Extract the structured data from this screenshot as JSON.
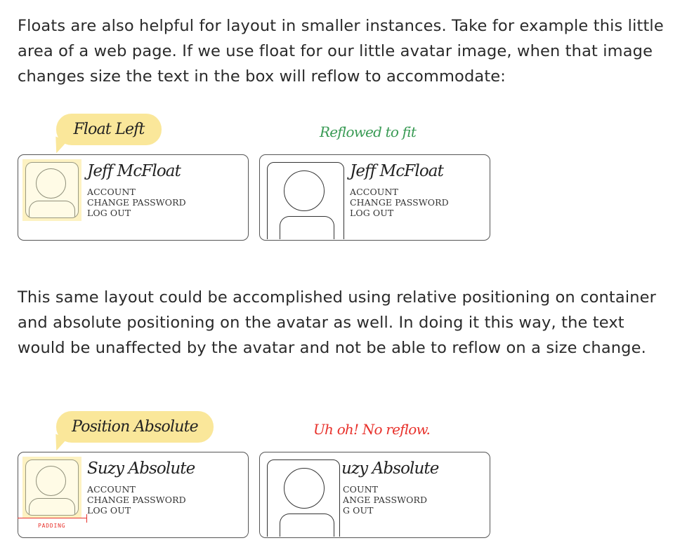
{
  "paragraphs": {
    "floats_intro": "Floats are also helpful for layout in smaller instances. Take for example this little area of a web page. If we use float for our little avatar image, when that image changes size the text in the box will reflow to accommodate:",
    "positioning_intro": "This same layout could be accomplished using relative positioning on container and absolute positioning on the avatar as well. In doing it this way, the text would be unaffected by the avatar and not be able to reflow on a size change."
  },
  "float_example": {
    "callout": "Float Left",
    "note": "Reflowed to fit",
    "note_color": "#3a9b55",
    "user_name": "Jeff McFloat",
    "links": [
      "ACCOUNT",
      "CHANGE PASSWORD",
      "LOG OUT"
    ]
  },
  "absolute_example": {
    "callout": "Position Absolute",
    "note": "Uh oh! No reflow.",
    "note_color": "#e8322c",
    "user_name": "Suzy Absolute",
    "user_name_clipped": "uzy Absolute",
    "links": [
      "ACCOUNT",
      "CHANGE PASSWORD",
      "LOG OUT"
    ],
    "links_clipped": [
      "COUNT",
      "ANGE PASSWORD",
      "G OUT"
    ],
    "padding_label": "PADDING"
  },
  "colors": {
    "callout_bg": "#fae79a",
    "highlight_bg": "#fdf2c2",
    "padding_marker": "#e8322c"
  },
  "icons": {
    "avatar": "user-avatar-icon"
  }
}
